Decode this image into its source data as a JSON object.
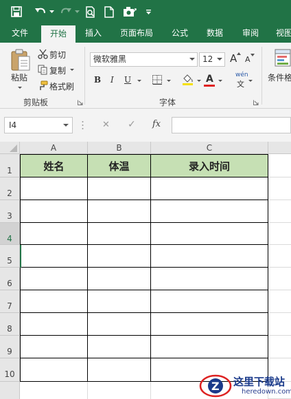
{
  "app": {
    "accent": "#217346"
  },
  "quick_access": {
    "icons": [
      "save-icon",
      "undo-icon",
      "redo-icon",
      "print-preview-icon",
      "new-document-icon",
      "camera-icon",
      "customize-qat-icon"
    ]
  },
  "tabs": [
    {
      "label": "文件",
      "active": false
    },
    {
      "label": "开始",
      "active": true
    },
    {
      "label": "插入",
      "active": false
    },
    {
      "label": "页面布局",
      "active": false
    },
    {
      "label": "公式",
      "active": false
    },
    {
      "label": "数据",
      "active": false
    },
    {
      "label": "审阅",
      "active": false
    },
    {
      "label": "视图",
      "active": false
    }
  ],
  "clipboard": {
    "paste_label": "粘贴",
    "cut_label": "剪切",
    "copy_label": "复制",
    "format_painter_label": "格式刷",
    "group_label": "剪贴板"
  },
  "font": {
    "name": "微软雅黑",
    "size": "12",
    "grow_label": "A",
    "shrink_label": "A",
    "bold_label": "B",
    "italic_label": "I",
    "underline_label": "U",
    "font_color_label": "A",
    "phonetic_label": "wén",
    "group_label": "字体"
  },
  "styles": {
    "conditional_format_label": "条件格"
  },
  "formula_bar": {
    "name_box": "I4",
    "cancel_label": "✕",
    "enter_label": "✓",
    "fx_label": "fx",
    "value": ""
  },
  "sheet": {
    "columns": [
      "A",
      "B",
      "C"
    ],
    "rows": [
      "1",
      "2",
      "3",
      "4",
      "5",
      "6",
      "7",
      "8",
      "9",
      "10"
    ],
    "selected_row": "4",
    "header_fill": "#c6e0b4",
    "table_headers": [
      "姓名",
      "体温",
      "录入时间"
    ]
  },
  "watermark": {
    "title": "这里下载站",
    "url": "heredown.com"
  }
}
